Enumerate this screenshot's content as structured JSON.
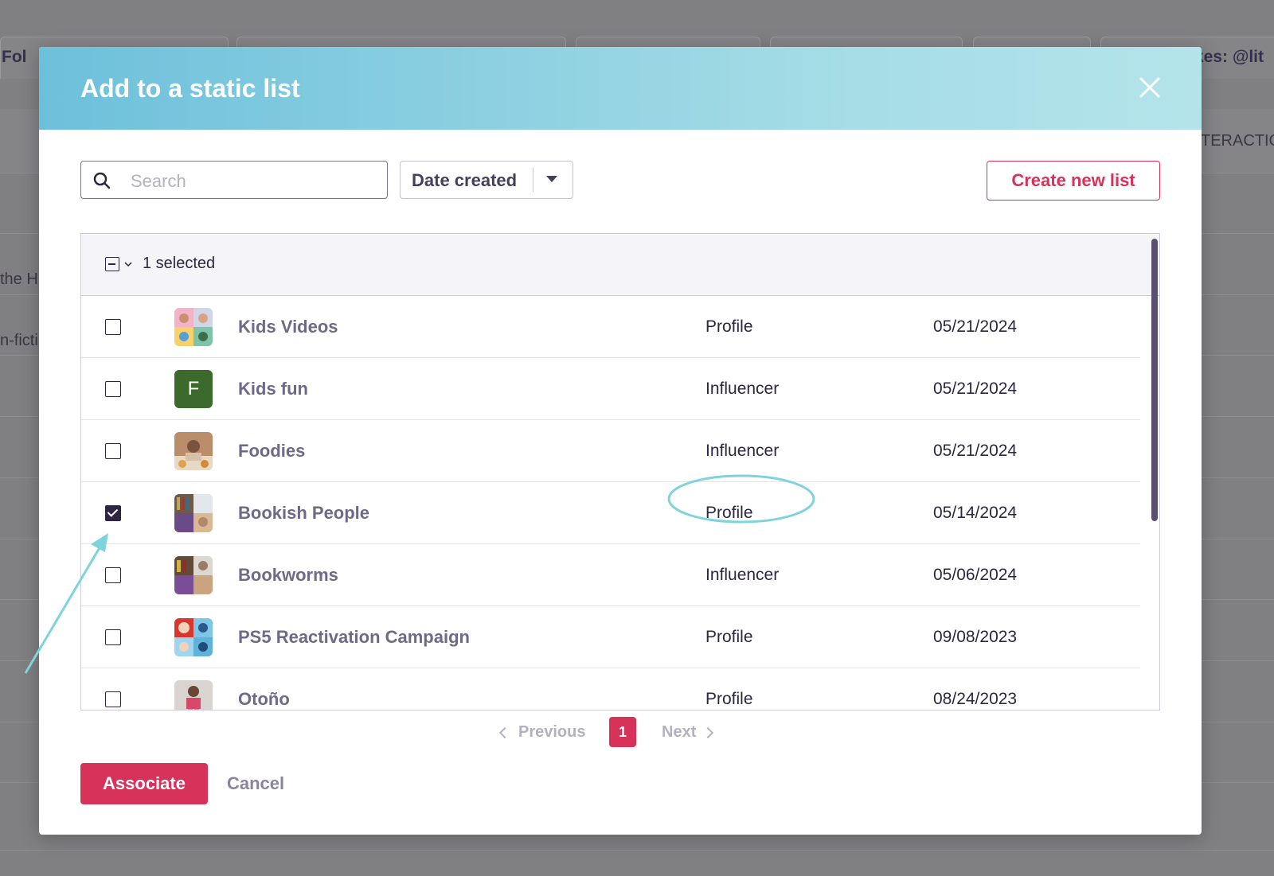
{
  "background": {
    "tab1_text": "Fol",
    "tab_right_text": "kes: @lit",
    "col_text": "TERACTIO",
    "row1_text": "the H",
    "row2_text": "n-ficti"
  },
  "modal": {
    "title": "Add to a static list",
    "search_placeholder": "Search",
    "sort_label": "Date created",
    "create_button": "Create new list",
    "selected_count": "1 selected",
    "rows": [
      {
        "name": "Kids Videos",
        "type": "Profile",
        "date": "05/21/2024",
        "checked": false,
        "avatar": "kids-videos-avatar"
      },
      {
        "name": "Kids fun",
        "type": "Influencer",
        "date": "05/21/2024",
        "checked": false,
        "avatar_letter": "F"
      },
      {
        "name": "Foodies",
        "type": "Influencer",
        "date": "05/21/2024",
        "checked": false,
        "avatar": "foodies-avatar"
      },
      {
        "name": "Bookish People",
        "type": "Profile",
        "date": "05/14/2024",
        "checked": true,
        "avatar": "bookish-avatar"
      },
      {
        "name": "Bookworms",
        "type": "Influencer",
        "date": "05/06/2024",
        "checked": false,
        "avatar": "bookworms-avatar"
      },
      {
        "name": "PS5 Reactivation Campaign",
        "type": "Profile",
        "date": "09/08/2023",
        "checked": false,
        "avatar": "ps5-avatar"
      },
      {
        "name": "Otoño",
        "type": "Profile",
        "date": "08/24/2023",
        "checked": false,
        "avatar": "otono-avatar"
      }
    ],
    "pagination": {
      "previous": "Previous",
      "current": "1",
      "next": "Next"
    },
    "associate_button": "Associate",
    "cancel_button": "Cancel"
  },
  "colors": {
    "accent": "#d6325a",
    "header_start": "#6dc0db",
    "header_end": "#b4e4ea",
    "annotation": "#7fd3dc"
  }
}
